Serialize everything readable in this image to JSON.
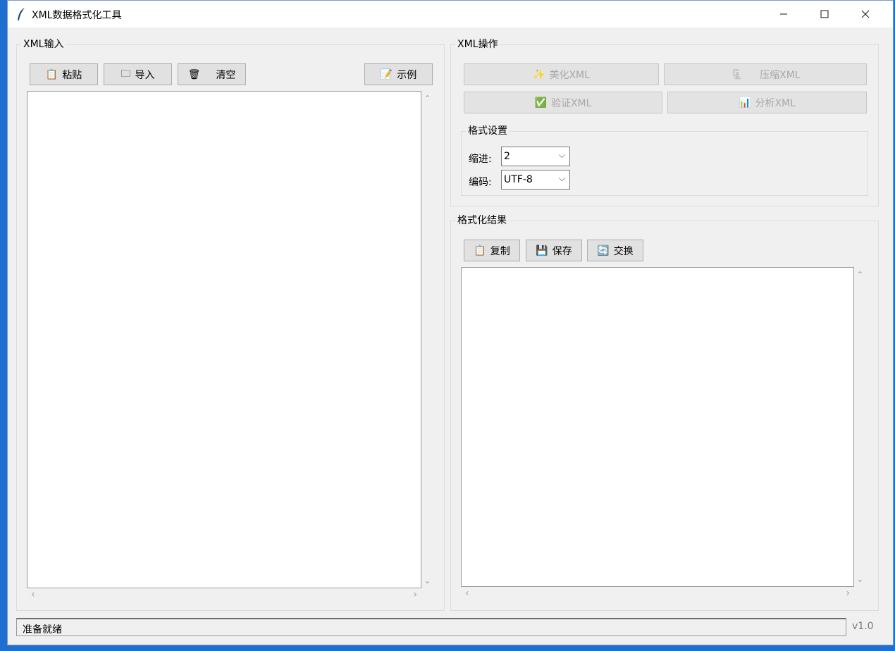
{
  "window": {
    "title": "XML数据格式化工具"
  },
  "input_panel": {
    "label": "XML输入",
    "paste": "粘贴",
    "import": "导入",
    "clear": "清空",
    "example": "示例"
  },
  "ops_panel": {
    "label": "XML操作",
    "beautify": "美化XML",
    "compress": "压缩XML",
    "validate": "验证XML",
    "analyze": "分析XML",
    "format_settings": {
      "label": "格式设置",
      "indent_label": "缩进:",
      "indent_value": "2",
      "encoding_label": "编码:",
      "encoding_value": "UTF-8"
    }
  },
  "result_panel": {
    "label": "格式化结果",
    "copy": "复制",
    "save": "保存",
    "swap": "交换"
  },
  "status": {
    "text": "准备就绪",
    "version": "v1.0"
  }
}
